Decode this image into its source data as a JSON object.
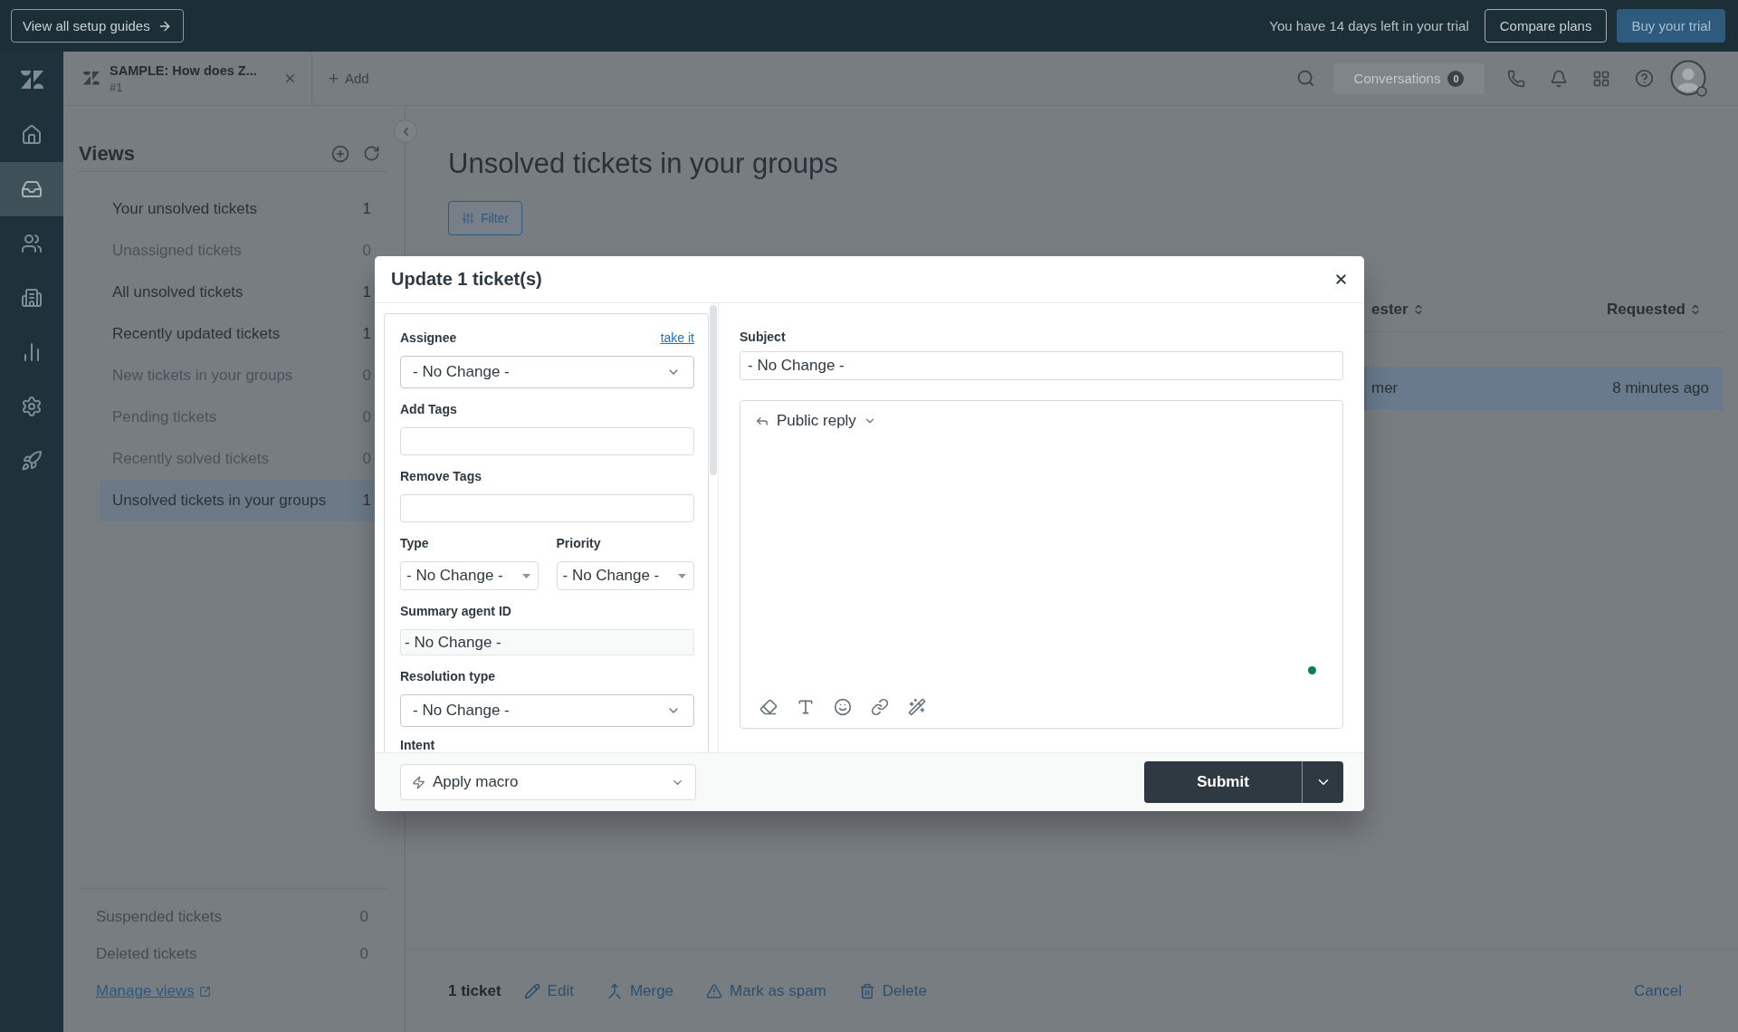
{
  "top_bar": {
    "guide_button": "View all setup guides",
    "trial_text": "You have 14 days left in your trial",
    "compare_button": "Compare plans",
    "buy_button": "Buy your trial"
  },
  "nav_rail": {
    "items": [
      {
        "kind": "home",
        "selected": false
      },
      {
        "kind": "tickets",
        "selected": true
      },
      {
        "kind": "customers",
        "selected": false
      },
      {
        "kind": "organizations",
        "selected": false
      },
      {
        "kind": "reporting",
        "selected": false
      },
      {
        "kind": "admin",
        "selected": false
      },
      {
        "kind": "getting-started",
        "selected": false
      }
    ]
  },
  "header": {
    "tabs": [
      {
        "title": "SAMPLE: How does Z...",
        "subtitle": "#1"
      }
    ],
    "add_button": "Add",
    "conversations": {
      "label": "Conversations",
      "count": "0"
    }
  },
  "views": {
    "title": "Views",
    "items": [
      {
        "label": "Your unsolved tickets",
        "count": "1",
        "selected": false,
        "dimmed": false
      },
      {
        "label": "Unassigned tickets",
        "count": "0",
        "selected": false,
        "dimmed": true
      },
      {
        "label": "All unsolved tickets",
        "count": "1",
        "selected": false,
        "dimmed": false
      },
      {
        "label": "Recently updated tickets",
        "count": "1",
        "selected": false,
        "dimmed": false
      },
      {
        "label": "New tickets in your groups",
        "count": "0",
        "selected": false,
        "dimmed": true
      },
      {
        "label": "Pending tickets",
        "count": "0",
        "selected": false,
        "dimmed": true
      },
      {
        "label": "Recently solved tickets",
        "count": "0",
        "selected": false,
        "dimmed": true
      },
      {
        "label": "Unsolved tickets in your groups",
        "count": "1",
        "selected": true,
        "dimmed": false
      }
    ],
    "extra_items": [
      {
        "label": "Suspended tickets",
        "count": "0"
      },
      {
        "label": "Deleted tickets",
        "count": "0"
      }
    ],
    "manage_link": "Manage views"
  },
  "main": {
    "title": "Unsolved tickets in your groups",
    "filter_button": "Filter",
    "table": {
      "columns": [
        {
          "label": "ester"
        },
        {
          "label": "Requested"
        }
      ],
      "rows": [
        {
          "cells": [
            "mer",
            "8 minutes ago"
          ],
          "selected": true
        }
      ]
    },
    "action_bar": {
      "count": "1 ticket",
      "actions": [
        {
          "kind": "edit",
          "label": "Edit"
        },
        {
          "kind": "merge",
          "label": "Merge"
        },
        {
          "kind": "spam",
          "label": "Mark as spam"
        },
        {
          "kind": "delete",
          "label": "Delete"
        }
      ],
      "cancel": "Cancel"
    }
  },
  "dialog": {
    "title": "Update 1 ticket(s)",
    "fields": [
      {
        "kind": "dropdown",
        "label": "Assignee",
        "link": "take it",
        "value": "- No Change -"
      },
      {
        "kind": "text",
        "label": "Add Tags"
      },
      {
        "kind": "text",
        "label": "Remove Tags"
      },
      {
        "kind": "pair",
        "items": [
          {
            "label": "Type",
            "value": "- No Change -"
          },
          {
            "label": "Priority",
            "value": "- No Change -"
          }
        ]
      },
      {
        "kind": "readonly",
        "label": "Summary agent ID",
        "value": "- No Change -"
      },
      {
        "kind": "dropdown",
        "label": "Resolution type",
        "value": "- No Change -"
      },
      {
        "kind": "label",
        "label": "Intent"
      }
    ],
    "subject": {
      "label": "Subject",
      "value": "- No Change -"
    },
    "reply_mode": "Public reply",
    "macro": "Apply macro",
    "submit": "Submit"
  }
}
